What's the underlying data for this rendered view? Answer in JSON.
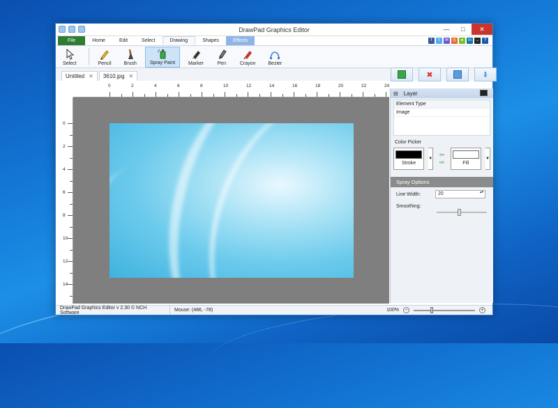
{
  "window": {
    "title": "DrawPad Graphics Editor",
    "controls": [
      "—",
      "□",
      "✕"
    ]
  },
  "ribbon_tabs": [
    {
      "label": "File",
      "style": "file"
    },
    {
      "label": "Home"
    },
    {
      "label": "Edit"
    },
    {
      "label": "Select"
    },
    {
      "label": "Drawing",
      "style": "active"
    },
    {
      "label": "Shapes"
    },
    {
      "label": "Effects",
      "style": "effects"
    }
  ],
  "social": {
    "colors": [
      "#3b5998",
      "#55acee",
      "#6a5acd",
      "#e36a2a",
      "#7bbf2a",
      "#0e76a8",
      "#222",
      "#1a5aa8"
    ],
    "glyphs": [
      "f",
      "t",
      "✉",
      "◎",
      "●",
      "in",
      "⌄",
      "?"
    ]
  },
  "tools": [
    {
      "label": "Select",
      "icon": "cursor-icon"
    },
    {
      "label": "Pencil",
      "icon": "pencil-icon"
    },
    {
      "label": "Brush",
      "icon": "brush-icon"
    },
    {
      "label": "Spray Paint",
      "icon": "spray-paint-icon",
      "selected": true
    },
    {
      "label": "Marker",
      "icon": "marker-icon"
    },
    {
      "label": "Pen",
      "icon": "pen-icon"
    },
    {
      "label": "Crayon",
      "icon": "crayon-icon"
    },
    {
      "label": "Bezier",
      "icon": "bezier-icon"
    }
  ],
  "documents": [
    {
      "label": "Untitled"
    },
    {
      "label": "3610.jpg",
      "active": true
    }
  ],
  "panel_buttons": [
    "add-layer-icon",
    "delete-layer-icon",
    "duplicate-layer-icon",
    "merge-layer-icon"
  ],
  "ruler": {
    "h_ticks": [
      "0",
      "2",
      "4",
      "6",
      "8",
      "10",
      "12",
      "14",
      "16",
      "18",
      "20",
      "22",
      "24"
    ],
    "v_ticks": [
      "0",
      "2",
      "4",
      "6",
      "8",
      "10",
      "12",
      "14"
    ]
  },
  "layer": {
    "header": "Layer",
    "column": "Element Type",
    "rows": [
      "Image"
    ]
  },
  "color_picker": {
    "label": "Color Picker",
    "stroke_label": "Stroke",
    "stroke_color": "#000000",
    "fill_label": "Fill",
    "fill_color": "#ffffff"
  },
  "spray_options": {
    "header": "Spray Options",
    "line_width_label": "Line Width:",
    "line_width": "20",
    "smoothing_label": "Smoothing:"
  },
  "status": {
    "app": "DrawPad Graphics Editor v 2.30 © NCH Software",
    "mouse": "Mouse: (486, -78)",
    "zoom": "100%"
  }
}
